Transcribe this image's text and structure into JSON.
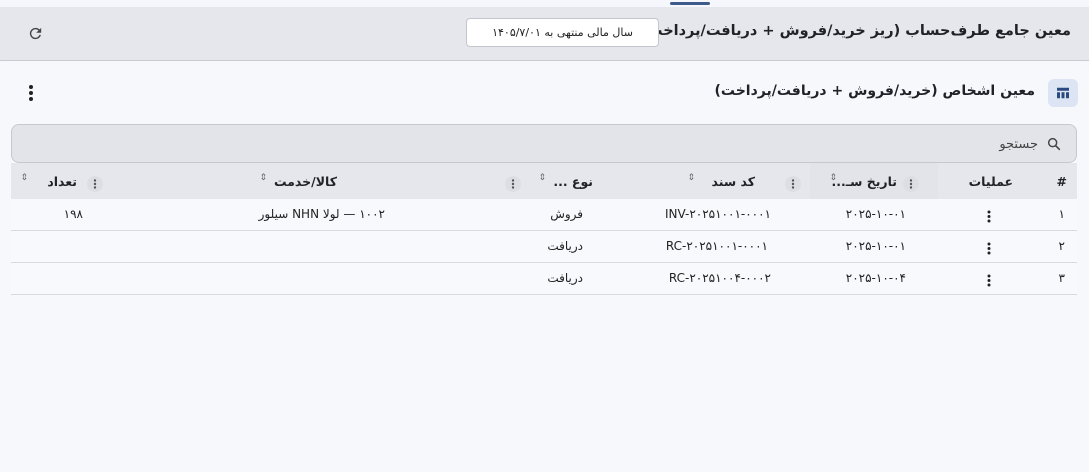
{
  "header": {
    "title": "معین جامع طرف‌حساب (ریز خرید/فروش + دریافت/پرداخت)",
    "fiscal_year_label": "سال مالی منتهی به ۱۴۰۵/۷/۰۱",
    "refresh_icon": "refresh-icon"
  },
  "panel": {
    "title": "معین اشخاص (خرید/فروش + دریافت/پرداخت)",
    "icon": "table-icon"
  },
  "search": {
    "placeholder": "جستجو"
  },
  "table": {
    "columns": {
      "index": "#",
      "ops": "عملیات",
      "date": "تاریخ سـ...",
      "code": "کد سند",
      "type": "نوع ...",
      "item": "کالا/خدمت",
      "qty": "تعداد"
    },
    "rows": [
      {
        "index": "۱",
        "date": "۲۰۲۵-۱۰-۰۱",
        "code": "INV-۲۰۲۵۱۰۰۱-۰۰۰۱",
        "type": "فروش",
        "item": "۱۰۰۲ — لولا NHN سیلور",
        "qty": "۱۹۸"
      },
      {
        "index": "۲",
        "date": "۲۰۲۵-۱۰-۰۱",
        "code": "RC-۲۰۲۵۱۰۰۱-۰۰۰۱",
        "type": "دریافت",
        "item": "",
        "qty": ""
      },
      {
        "index": "۳",
        "date": "۲۰۲۵-۱۰-۰۴",
        "code": "RC-۲۰۲۵۱۰۰۴-۰۰۰۲",
        "type": "دریافت",
        "item": "",
        "qty": ""
      }
    ]
  },
  "colors": {
    "header_bg": "#e6e7ec",
    "panel_bg": "#f7f8fc",
    "accent": "#3d5a8a"
  }
}
